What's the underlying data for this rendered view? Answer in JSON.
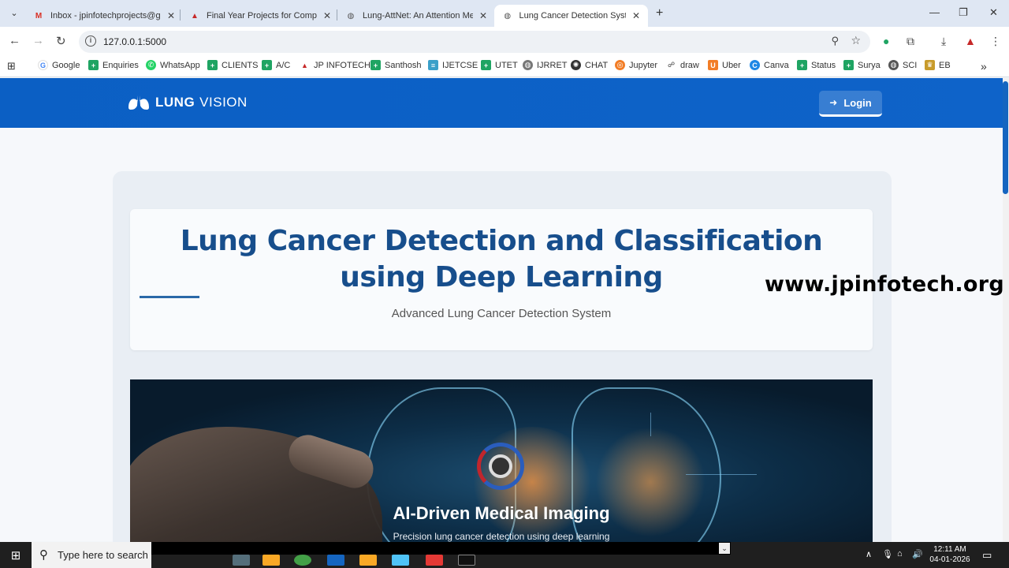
{
  "browser": {
    "tabs": [
      {
        "title": "Inbox - jpinfotechprojects@gm",
        "icon": "gmail-icon",
        "active": false
      },
      {
        "title": "Final Year Projects for Compute",
        "icon": "jp-infotech-icon",
        "active": false
      },
      {
        "title": "Lung-AttNet: An Attention Mec",
        "icon": "globe-icon",
        "active": false
      },
      {
        "title": "Lung Cancer Detection System",
        "icon": "globe-icon",
        "active": true
      }
    ],
    "url": "127.0.0.1:5000",
    "bookmarks": [
      {
        "label": "Google",
        "icon": "google-icon"
      },
      {
        "label": "Enquiries",
        "icon": "sheets-icon"
      },
      {
        "label": "WhatsApp",
        "icon": "whatsapp-icon"
      },
      {
        "label": "CLIENTS",
        "icon": "sheets-icon"
      },
      {
        "label": "A/C",
        "icon": "sheets-icon"
      },
      {
        "label": "JP INFOTECH",
        "icon": "jp-infotech-icon"
      },
      {
        "label": "Santhosh",
        "icon": "sheets-icon"
      },
      {
        "label": "IJETCSE",
        "icon": "journal-icon"
      },
      {
        "label": "UTET",
        "icon": "sheets-icon"
      },
      {
        "label": "IJRRET",
        "icon": "globe-icon"
      },
      {
        "label": "CHAT",
        "icon": "openai-icon"
      },
      {
        "label": "Jupyter",
        "icon": "jupyter-icon"
      },
      {
        "label": "draw",
        "icon": "draw-icon"
      },
      {
        "label": "Uber",
        "icon": "uber-icon"
      },
      {
        "label": "Canva",
        "icon": "canva-icon"
      },
      {
        "label": "Status",
        "icon": "sheets-icon"
      },
      {
        "label": "Surya",
        "icon": "sheets-icon"
      },
      {
        "label": "SCI",
        "icon": "globe-icon"
      },
      {
        "label": "EB",
        "icon": "emblem-icon"
      }
    ],
    "more_bookmarks": "»"
  },
  "site": {
    "logo_bold": "LUNG",
    "logo_light": "VISION",
    "login_label": "Login",
    "hero_title": "Lung Cancer Detection and Classification using Deep Learning",
    "hero_subtitle": "Advanced Lung Cancer Detection System",
    "watermark": "www.jpinfotech.org",
    "banner_title": "AI-Driven Medical Imaging",
    "banner_subtitle": "Precision lung cancer detection using deep learning"
  },
  "taskbar": {
    "search_placeholder": "Type here to search",
    "time": "12:11 AM",
    "date": "04-01-2026"
  },
  "colors": {
    "header_blue": "#0b5fc4",
    "title_blue": "#174e8c",
    "accent_line": "#2b69a8"
  }
}
